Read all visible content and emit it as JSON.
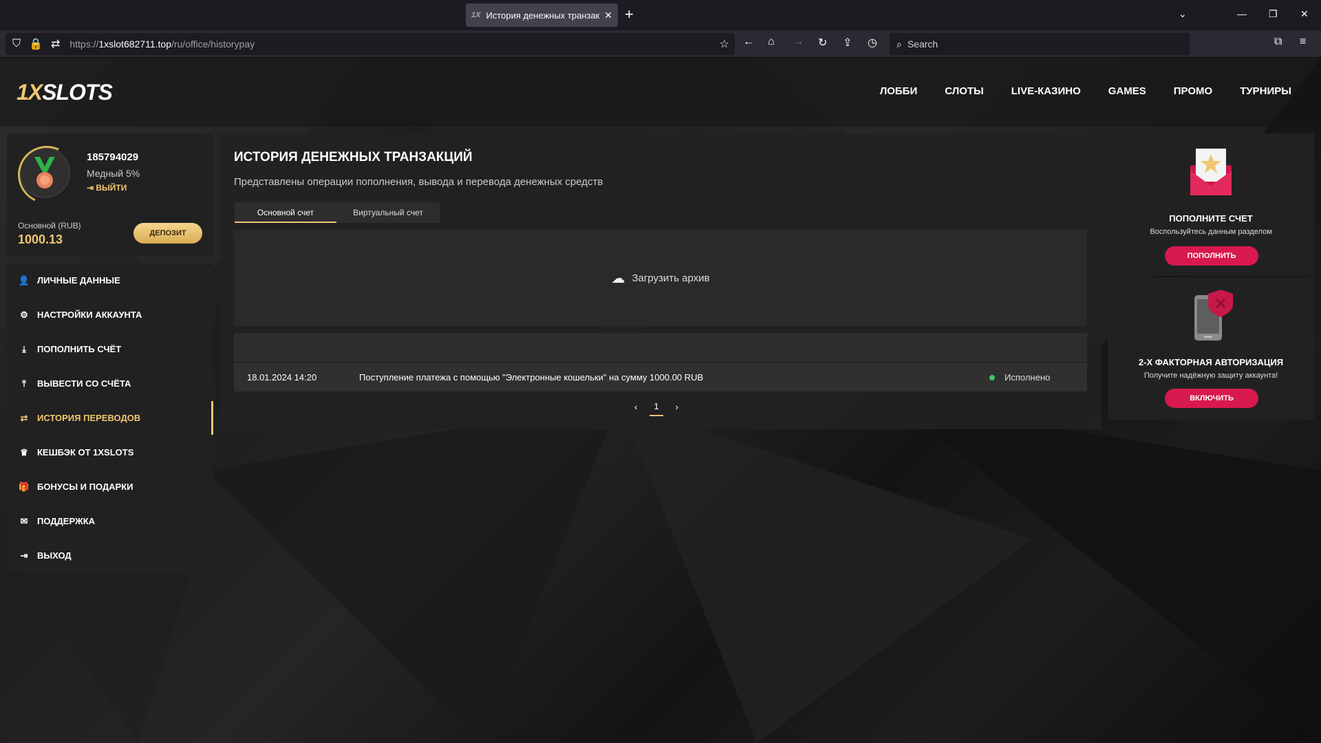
{
  "browser": {
    "tab_title": "История денежных транзакций",
    "tab_favicon": "1X",
    "url_prefix": "https://",
    "url_domain": "1xslot682711.top",
    "url_path": "/ru/office/historypay",
    "search_placeholder": "Search"
  },
  "site": {
    "logo_part1": "1X",
    "logo_part2": "SLOTS",
    "nav": [
      "ЛОББИ",
      "СЛОТЫ",
      "LIVE-КАЗИНО",
      "GAMES",
      "ПРОМО",
      "ТУРНИРЫ"
    ]
  },
  "profile": {
    "user_id": "185794029",
    "rank": "Медный 5%",
    "logout": "ВЫЙТИ",
    "account_label": "Основной (RUB)",
    "balance": "1000.13",
    "deposit_button": "ДЕПОЗИТ"
  },
  "menu": [
    {
      "label": "ЛИЧНЫЕ ДАННЫЕ",
      "icon": "user-plus-icon",
      "glyph": "👤"
    },
    {
      "label": "НАСТРОЙКИ АККАУНТА",
      "icon": "gears-icon",
      "glyph": "⚙"
    },
    {
      "label": "ПОПОЛНИТЬ СЧЁТ",
      "icon": "download-icon",
      "glyph": "⤓"
    },
    {
      "label": "ВЫВЕСТИ СО СЧЁТА",
      "icon": "upload-icon",
      "glyph": "⤒"
    },
    {
      "label": "ИСТОРИЯ ПЕРЕВОДОВ",
      "icon": "exchange-icon",
      "glyph": "⇄",
      "active": true
    },
    {
      "label": "КЕШБЭК ОТ 1XSLOTS",
      "icon": "crown-icon",
      "glyph": "♛"
    },
    {
      "label": "БОНУСЫ И ПОДАРКИ",
      "icon": "gift-icon",
      "glyph": "🎁"
    },
    {
      "label": "ПОДДЕРЖКА",
      "icon": "envelope-icon",
      "glyph": "✉"
    },
    {
      "label": "ВЫХОД",
      "icon": "sign-out-icon",
      "glyph": "⇥"
    }
  ],
  "main": {
    "title": "ИСТОРИЯ ДЕНЕЖНЫХ ТРАНЗАКЦИЙ",
    "subtitle": "Представлены операции пополнения, вывода и перевода денежных средств",
    "tabs": [
      "Основной счет",
      "Виртуальный счет"
    ],
    "archive_label": "Загрузить архив",
    "rows": [
      {
        "date": "18.01.2024 14:20",
        "text": "Поступление платежа с помощью \"Электронные кошельки\" на сумму 1000.00 RUB",
        "status": "Исполнено"
      }
    ],
    "page": "1"
  },
  "widgets": {
    "deposit": {
      "title": "ПОПОЛНИТЕ СЧЕТ",
      "subtitle": "Воспользуйтесь данным разделом",
      "button": "ПОПОЛНИТЬ"
    },
    "twofa": {
      "title": "2-Х ФАКТОРНАЯ АВТОРИЗАЦИЯ",
      "subtitle": "Получите надёжную защиту аккаунта!",
      "button": "ВКЛЮЧИТЬ"
    }
  },
  "colors": {
    "accent_gold": "#f0c772",
    "accent_pink": "#d8194d",
    "status_green": "#3ec46d"
  }
}
